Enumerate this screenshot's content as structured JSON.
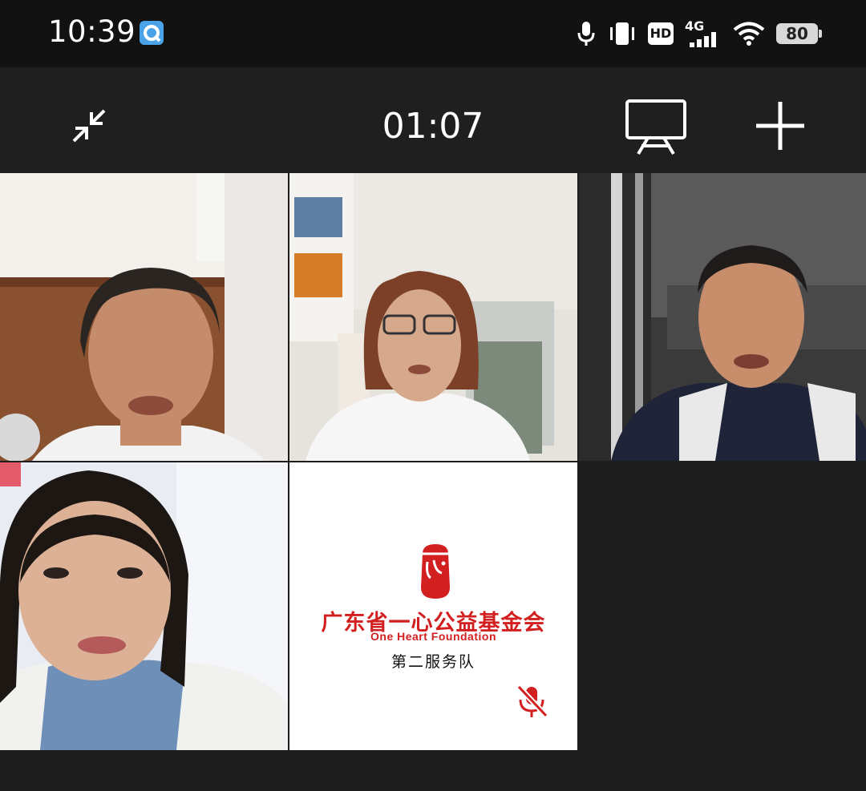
{
  "status_bar": {
    "time": "10:39",
    "app_icon": "qq-browser-icon",
    "icons": [
      "microphone-icon",
      "vibrate-icon",
      "hd-icon",
      "4g-signal-icon",
      "wifi-icon"
    ],
    "hd_label": "HD",
    "network_label": "4G",
    "battery_level": "80"
  },
  "call_bar": {
    "timer": "01:07",
    "icons": [
      "minimize-icon",
      "screen-share-icon",
      "add-participant-icon"
    ]
  },
  "participants": [
    {
      "id": "participant-1",
      "video": true
    },
    {
      "id": "participant-2",
      "video": true
    },
    {
      "id": "participant-3",
      "video": true
    },
    {
      "id": "participant-4",
      "video": true
    },
    {
      "id": "participant-5",
      "video": false,
      "muted": true
    }
  ],
  "avatar_card": {
    "org_name_cn": "广东省一心公益基金会",
    "org_name_en": "One Heart  Foundation",
    "team_name": "第二服务队"
  },
  "colors": {
    "brand_red": "#d21f1f",
    "background": "#1d1d1d"
  }
}
